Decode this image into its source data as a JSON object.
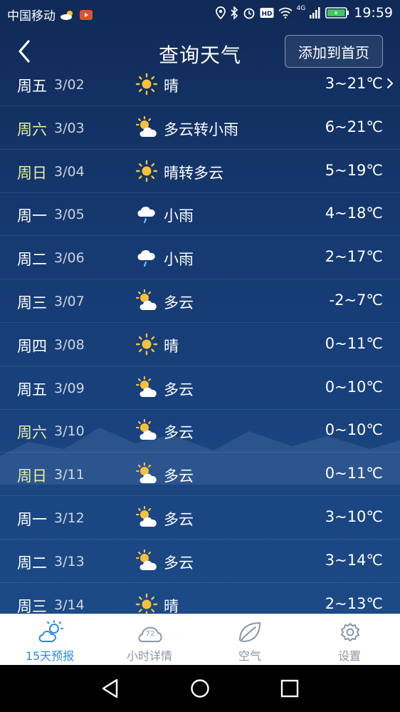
{
  "status_bar": {
    "carrier": "中国移动",
    "network": "4G",
    "time": "19:59"
  },
  "header": {
    "title": "查询天气",
    "add_button": "添加到首页"
  },
  "forecast": [
    {
      "day": "周五",
      "date": "3/02",
      "icon": "sun-icon",
      "condition": "晴",
      "temp": "3~21℃",
      "weekend": false
    },
    {
      "day": "周六",
      "date": "3/03",
      "icon": "partly-cloudy-icon",
      "condition": "多云转小雨",
      "temp": "6~21℃",
      "weekend": true
    },
    {
      "day": "周日",
      "date": "3/04",
      "icon": "sun-icon",
      "condition": "晴转多云",
      "temp": "5~19℃",
      "weekend": true
    },
    {
      "day": "周一",
      "date": "3/05",
      "icon": "light-rain-icon",
      "condition": "小雨",
      "temp": "4~18℃",
      "weekend": false
    },
    {
      "day": "周二",
      "date": "3/06",
      "icon": "light-rain-icon",
      "condition": "小雨",
      "temp": "2~17℃",
      "weekend": false
    },
    {
      "day": "周三",
      "date": "3/07",
      "icon": "partly-cloudy-icon",
      "condition": "多云",
      "temp": "-2~7℃",
      "weekend": false
    },
    {
      "day": "周四",
      "date": "3/08",
      "icon": "sun-icon",
      "condition": "晴",
      "temp": "0~11℃",
      "weekend": false
    },
    {
      "day": "周五",
      "date": "3/09",
      "icon": "partly-cloudy-icon",
      "condition": "多云",
      "temp": "0~10℃",
      "weekend": false
    },
    {
      "day": "周六",
      "date": "3/10",
      "icon": "partly-cloudy-icon",
      "condition": "多云",
      "temp": "0~10℃",
      "weekend": true
    },
    {
      "day": "周日",
      "date": "3/11",
      "icon": "partly-cloudy-icon",
      "condition": "多云",
      "temp": "0~11℃",
      "weekend": true
    },
    {
      "day": "周一",
      "date": "3/12",
      "icon": "partly-cloudy-icon",
      "condition": "多云",
      "temp": "3~10℃",
      "weekend": false
    },
    {
      "day": "周二",
      "date": "3/13",
      "icon": "partly-cloudy-icon",
      "condition": "多云",
      "temp": "3~14℃",
      "weekend": false
    },
    {
      "day": "周三",
      "date": "3/14",
      "icon": "sun-icon",
      "condition": "晴",
      "temp": "2~13℃",
      "weekend": false
    }
  ],
  "tabs": [
    {
      "label": "15天预报",
      "icon": "forecast-15day-icon",
      "active": true
    },
    {
      "label": "小时详情",
      "icon": "hourly-72-icon",
      "active": false
    },
    {
      "label": "空气",
      "icon": "leaf-icon",
      "active": false
    },
    {
      "label": "设置",
      "icon": "gear-icon",
      "active": false
    }
  ],
  "hourly_badge": "72",
  "colors": {
    "accent": "#2b8be0",
    "weekend_text": "#e8f0a2",
    "sun": "#f7c23a"
  }
}
